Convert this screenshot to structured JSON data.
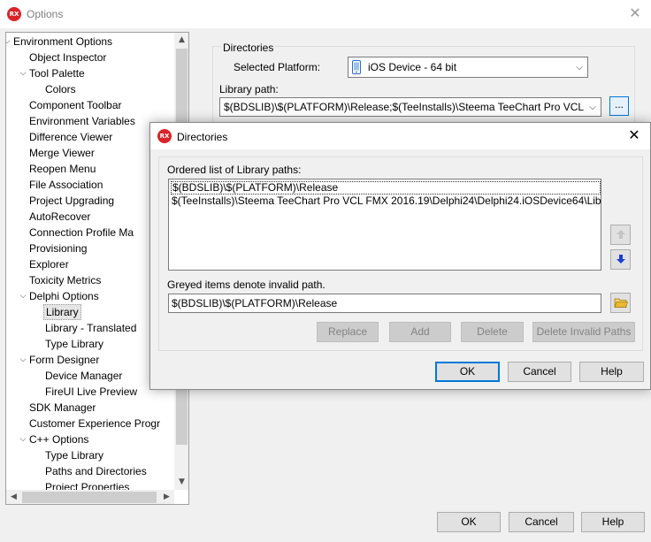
{
  "window": {
    "title": "Options"
  },
  "tree": {
    "items": [
      {
        "label": "Environment Options",
        "level": 0,
        "expanded": true
      },
      {
        "label": "Object Inspector",
        "level": 1
      },
      {
        "label": "Tool Palette",
        "level": 1,
        "expanded": true
      },
      {
        "label": "Colors",
        "level": 2
      },
      {
        "label": "Component Toolbar",
        "level": 1
      },
      {
        "label": "Environment Variables",
        "level": 1
      },
      {
        "label": "Difference Viewer",
        "level": 1
      },
      {
        "label": "Merge Viewer",
        "level": 1
      },
      {
        "label": "Reopen Menu",
        "level": 1
      },
      {
        "label": "File Association",
        "level": 1
      },
      {
        "label": "Project Upgrading",
        "level": 1
      },
      {
        "label": "AutoRecover",
        "level": 1
      },
      {
        "label": "Connection Profile Ma",
        "level": 1
      },
      {
        "label": "Provisioning",
        "level": 1
      },
      {
        "label": "Explorer",
        "level": 1
      },
      {
        "label": "Toxicity Metrics",
        "level": 1
      },
      {
        "label": "Delphi Options",
        "level": 1,
        "expanded": true
      },
      {
        "label": "Library",
        "level": 2,
        "selected": true
      },
      {
        "label": "Library - Translated",
        "level": 2
      },
      {
        "label": "Type Library",
        "level": 2
      },
      {
        "label": "Form Designer",
        "level": 1,
        "expanded": true
      },
      {
        "label": "Device Manager",
        "level": 2
      },
      {
        "label": "FireUI Live Preview",
        "level": 2
      },
      {
        "label": "SDK Manager",
        "level": 1
      },
      {
        "label": "Customer Experience Progr",
        "level": 1
      },
      {
        "label": "C++ Options",
        "level": 1,
        "expanded": true
      },
      {
        "label": "Type Library",
        "level": 2
      },
      {
        "label": "Paths and Directories",
        "level": 2
      },
      {
        "label": "Project Properties",
        "level": 2
      }
    ]
  },
  "directories": {
    "legend": "Directories",
    "platform_label": "Selected Platform:",
    "platform_value": "iOS Device - 64 bit",
    "library_label": "Library path:",
    "library_value": "$(BDSLIB)\\$(PLATFORM)\\Release;$(TeeInstalls)\\Steema TeeChart Pro VCL FMX",
    "ellipsis": "..."
  },
  "footer": {
    "ok": "OK",
    "cancel": "Cancel",
    "help": "Help"
  },
  "dialog": {
    "title": "Directories",
    "list_label": "Ordered list of Library paths:",
    "list_items": [
      "$(BDSLIB)\\$(PLATFORM)\\Release",
      "$(TeeInstalls)\\Steema TeeChart Pro VCL FMX 2016.19\\Delphi24\\Delphi24.iOSDevice64\\Lib"
    ],
    "greyed_note": "Greyed items denote invalid path.",
    "edit_value": "$(BDSLIB)\\$(PLATFORM)\\Release",
    "buttons": {
      "replace": "Replace",
      "add": "Add",
      "delete": "Delete",
      "delete_invalid": "Delete Invalid Paths",
      "ok": "OK",
      "cancel": "Cancel",
      "help": "Help"
    }
  },
  "icons": {
    "app": "rx-logo",
    "move_up": "arrow-up-icon",
    "move_down": "arrow-down-icon",
    "browse": "folder-icon",
    "device": "mobile-device-icon"
  },
  "colors": {
    "accent": "#0078d7",
    "logo": "#d9232a",
    "down_arrow": "#1a3fd6",
    "folder": "#e8b931"
  }
}
